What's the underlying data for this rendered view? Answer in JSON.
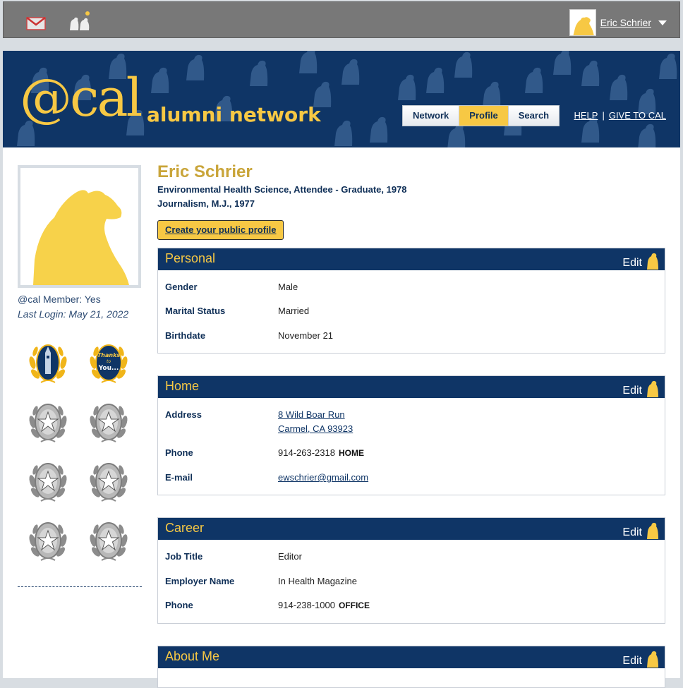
{
  "topbar": {
    "user_name": "Eric Schrier"
  },
  "banner": {
    "logo_at": "@cal",
    "logo_text": "alumni network",
    "tabs": [
      "Network",
      "Profile",
      "Search"
    ],
    "active_tab": "Profile",
    "links": {
      "help": "HELP",
      "separator": "|",
      "give": "GIVE TO CAL"
    }
  },
  "sidebar": {
    "member": "@cal Member: Yes",
    "last_login": "Last Login: May 21, 2022",
    "badge_badge2_text": [
      "Thanks",
      "to",
      "You..."
    ]
  },
  "profile": {
    "name": "Eric Schrier",
    "degrees": [
      "Environmental Health Science, Attendee - Graduate, 1978",
      "Journalism, M.J., 1977"
    ],
    "public_profile_button": "Create your public profile"
  },
  "sections": {
    "edit_label": "Edit",
    "personal": {
      "title": "Personal",
      "rows": [
        {
          "label": "Gender",
          "value": "Male"
        },
        {
          "label": "Marital Status",
          "value": "Married"
        },
        {
          "label": "Birthdate",
          "value": "November 21"
        }
      ]
    },
    "home": {
      "title": "Home",
      "address_label": "Address",
      "address_line1": "8 Wild Boar Run",
      "address_line2": "Carmel, CA 93923",
      "phone_label": "Phone",
      "phone_value": "914-263-2318",
      "phone_tag": "HOME",
      "email_label": "E-mail",
      "email_value": "ewschrier@gmail.com"
    },
    "career": {
      "title": "Career",
      "job_label": "Job Title",
      "job_value": "Editor",
      "employer_label": "Employer Name",
      "employer_value": "In Health Magazine",
      "phone_label": "Phone",
      "phone_value": "914-238-1000",
      "phone_tag": "OFFICE"
    },
    "about": {
      "title": "About Me"
    }
  },
  "colors": {
    "navy": "#0f3566",
    "gold": "#f7c844",
    "name_gold": "#c9a53a"
  }
}
